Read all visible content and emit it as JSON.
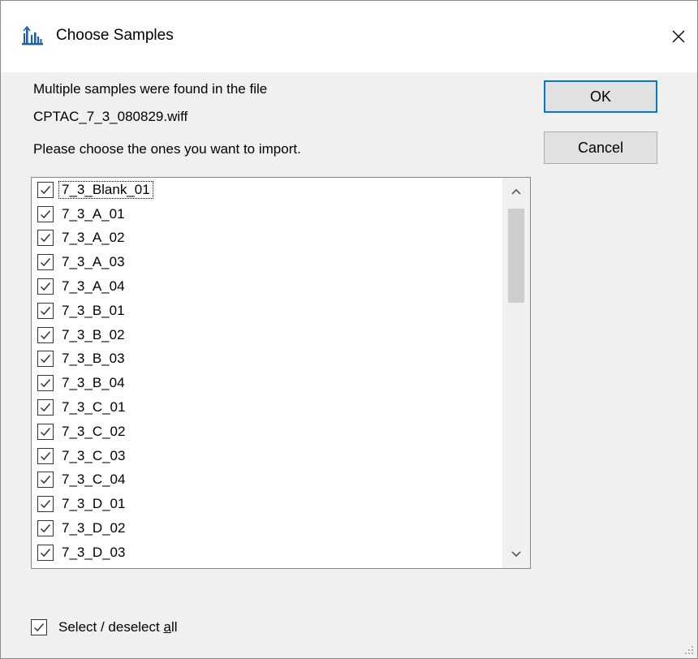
{
  "window": {
    "title": "Choose Samples",
    "icon": "skyline-app-icon",
    "close_glyph": "✕"
  },
  "message": {
    "line1": "Multiple samples were found in the file",
    "line2": "CPTAC_7_3_080829.wiff",
    "line3": "Please choose the ones you want to import."
  },
  "buttons": {
    "ok": "OK",
    "cancel": "Cancel"
  },
  "samples": [
    {
      "label": "7_3_Blank_01",
      "checked": true
    },
    {
      "label": "7_3_A_01",
      "checked": true
    },
    {
      "label": "7_3_A_02",
      "checked": true
    },
    {
      "label": "7_3_A_03",
      "checked": true
    },
    {
      "label": "7_3_A_04",
      "checked": true
    },
    {
      "label": "7_3_B_01",
      "checked": true
    },
    {
      "label": "7_3_B_02",
      "checked": true
    },
    {
      "label": "7_3_B_03",
      "checked": true
    },
    {
      "label": "7_3_B_04",
      "checked": true
    },
    {
      "label": "7_3_C_01",
      "checked": true
    },
    {
      "label": "7_3_C_02",
      "checked": true
    },
    {
      "label": "7_3_C_03",
      "checked": true
    },
    {
      "label": "7_3_C_04",
      "checked": true
    },
    {
      "label": "7_3_D_01",
      "checked": true
    },
    {
      "label": "7_3_D_02",
      "checked": true
    },
    {
      "label": "7_3_D_03",
      "checked": true
    }
  ],
  "select_all": {
    "label_prefix": "Select / deselect ",
    "label_access_key": "a",
    "label_suffix": "ll",
    "checked": true
  },
  "colors": {
    "accent": "#0078d7",
    "icon_blue": "#1f5fa8"
  }
}
